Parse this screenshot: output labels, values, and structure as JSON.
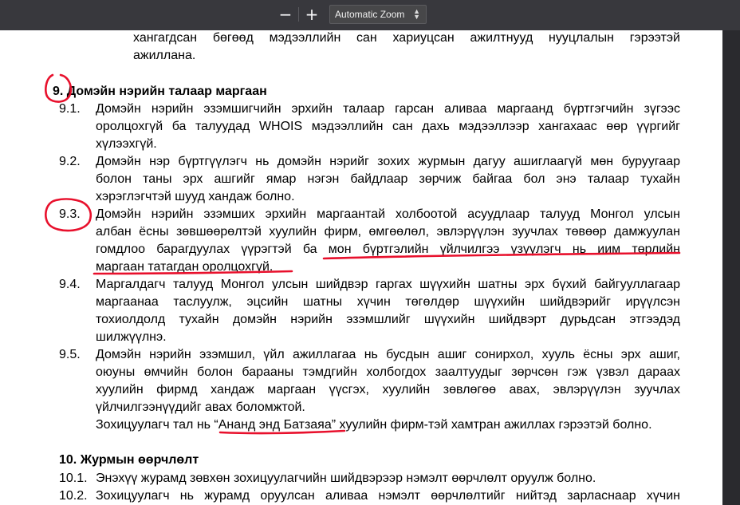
{
  "toolbar": {
    "zoom_out": "−",
    "zoom_in": "+",
    "zoom_level": "Automatic Zoom"
  },
  "document": {
    "prev_lines": [
      "хангагдсан бөгөөд мэдээллийн сан хариуцсан ажилтнууд нууцлалын гэрээтэй",
      "ажиллана."
    ],
    "section9": {
      "number": "9.",
      "title": "Домэйн нэрийн талаар маргаан",
      "items": [
        {
          "num": "9.1.",
          "lines": [
            "Домэйн нэрийн эзэмшигчийн эрхийн талаар гарсан аливаа маргаанд бүртгэгчийн зүгээс",
            "оролцохгүй ба талуудад WHOIS мэдээллийн сан дахь мэдээллээр хангахаас өөр үүргийг",
            "хүлээхгүй."
          ]
        },
        {
          "num": "9.2.",
          "lines": [
            " Домэйн нэр бүртгүүлэгч нь домэйн нэрийг зохих журмын дагуу ашиглаагүй мөн буруугаар",
            "болон таны эрх ашгийг ямар нэгэн байдлаар зөрчиж байгаа бол энэ талаар тухайн",
            "хэрэглэгчтэй шууд хандаж болно."
          ]
        },
        {
          "num": "9.3.",
          "lines": [
            "Домэйн нэрийн эзэмших эрхийн маргаантай холбоотой асуудлаар талууд Монгол улсын",
            "албан ёсны зөвшөөрөлтэй хуулийн фирм, өмгөөлөл, эвлэрүүлэн зуучлах төвөөр дамжуулан",
            "гомдлоо барагдуулах үүрэгтэй ба  мон бүртгэлийн үйлчилгээ үзүүлэгч нь иим төрлийн",
            "маргаан татагдан оролцохгүй."
          ]
        },
        {
          "num": "9.4.",
          "lines": [
            "Маргалдагч талууд Монгол улсын шийдвэр гаргах шүүхийн шатны эрх бүхий байгууллагаар",
            "маргаанаа таслуулж, эцсийн шатны хүчин төгөлдөр шүүхийн шийдвэрийг ирүүлсэн",
            "тохиолдолд тухайн домэйн нэрийн эзэмшлийг шүүхийн шийдвэрт дурьдсан этгээдэд",
            "шилжүүлнэ."
          ]
        },
        {
          "num": "9.5.",
          "lines": [
            "Домэйн нэрийн эзэмшил, үйл ажиллагаа нь бусдын ашиг сонирхол, хууль  ёсны эрх ашиг,",
            "оюуны өмчийн болон барааны тэмдгийн  холбогдох заалтуудыг зөрчсөн  гэж үзвэл дараах",
            "хуулийн фирмд хандаж маргаан үүсгэх, хуулийн зөвлөгөө авах, эвлэрүүлэн зуучлах",
            "үйлчилгээнүүдийг авах боломжтой."
          ]
        }
      ],
      "closing": "Зохицуулагч тал нь “Ананд энд Батзаяа” хуулийн фирм-тэй хамтран ажиллах гэрээтэй болно."
    },
    "section10": {
      "number": "10.",
      "title": "Журмын өөрчлөлт",
      "items": [
        {
          "num": "10.1.",
          "lines": [
            "Энэхүү журамд зөвхөн зохицуулагчийн шийдвэрээр нэмэлт өөрчлөлт оруулж болно."
          ]
        },
        {
          "num": "10.2.",
          "lines": [
            "Зохицуулагч нь журамд  оруулсан аливаа нэмэлт өөрчлөлтийг нийтэд зарласнаар хүчин"
          ]
        }
      ]
    }
  },
  "colors": {
    "annotation": "#e8102c",
    "toolbar": "#38383d"
  }
}
